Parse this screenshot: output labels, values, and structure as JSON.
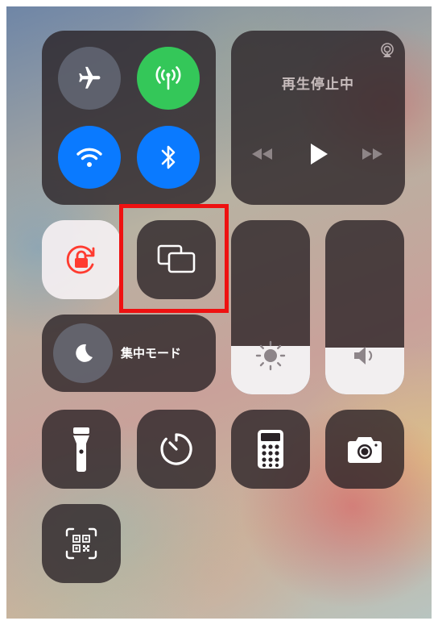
{
  "connectivity": {
    "airplane": "airplane-mode",
    "cellular": "cellular-data",
    "wifi": "wi-fi",
    "bluetooth": "bluetooth"
  },
  "media": {
    "status_text": "再生停止中"
  },
  "focus": {
    "label": "集中モード"
  },
  "sliders": {
    "brightness_level": 0.28,
    "volume_level": 0.27
  },
  "icons": {
    "airplane": "airplane-icon",
    "cellular": "antenna-icon",
    "wifi": "wifi-icon",
    "bluetooth": "bluetooth-icon",
    "airplay": "airplay-icon",
    "rewind": "rewind-icon",
    "play": "play-icon",
    "fast_forward": "fast-forward-icon",
    "rotation_lock": "rotation-lock-icon",
    "screen_mirroring": "screen-mirroring-icon",
    "moon": "moon-icon",
    "sun": "sun-icon",
    "speaker": "speaker-icon",
    "flashlight": "flashlight-icon",
    "timer": "timer-icon",
    "calculator": "calculator-icon",
    "camera": "camera-icon",
    "qr_scanner": "qr-code-icon"
  },
  "colors": {
    "green": "#34c759",
    "blue": "#0a7aff",
    "highlight": "#ee1111",
    "rotation_lock": "#ff3b30"
  }
}
